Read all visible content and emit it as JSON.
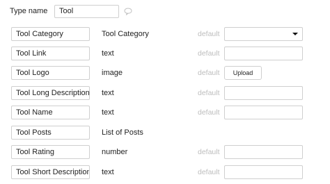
{
  "type_name": {
    "label": "Type name",
    "value": "Tool"
  },
  "default_label": "default",
  "upload_label": "Upload",
  "fields": [
    {
      "name": "Tool Category",
      "type": "Tool Category",
      "default_control": "select"
    },
    {
      "name": "Tool Link",
      "type": "text",
      "default_control": "input"
    },
    {
      "name": "Tool Logo",
      "type": "image",
      "default_control": "upload"
    },
    {
      "name": "Tool Long Description",
      "type": "text",
      "default_control": "input"
    },
    {
      "name": "Tool Name",
      "type": "text",
      "default_control": "input"
    },
    {
      "name": "Tool Posts",
      "type": "List of Posts",
      "default_control": "none"
    },
    {
      "name": "Tool Rating",
      "type": "number",
      "default_control": "input"
    },
    {
      "name": "Tool Short Description",
      "type": "text",
      "default_control": "input"
    }
  ]
}
